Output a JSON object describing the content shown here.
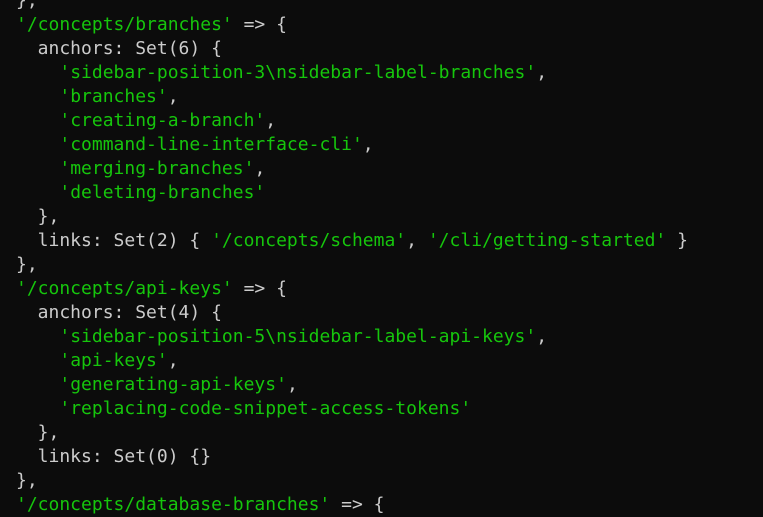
{
  "colors": {
    "background": "#0c0c0c",
    "text": "#cccccc",
    "string": "#16c60c"
  },
  "lines": [
    [
      {
        "t": "p",
        "v": "},"
      }
    ],
    [
      {
        "t": "s",
        "v": "'/concepts/branches'"
      },
      {
        "t": "p",
        "v": " => {"
      }
    ],
    [
      {
        "t": "p",
        "v": "  anchors: Set(6) {"
      }
    ],
    [
      {
        "t": "p",
        "v": "    "
      },
      {
        "t": "s",
        "v": "'sidebar-position-3\\nsidebar-label-branches'"
      },
      {
        "t": "p",
        "v": ","
      }
    ],
    [
      {
        "t": "p",
        "v": "    "
      },
      {
        "t": "s",
        "v": "'branches'"
      },
      {
        "t": "p",
        "v": ","
      }
    ],
    [
      {
        "t": "p",
        "v": "    "
      },
      {
        "t": "s",
        "v": "'creating-a-branch'"
      },
      {
        "t": "p",
        "v": ","
      }
    ],
    [
      {
        "t": "p",
        "v": "    "
      },
      {
        "t": "s",
        "v": "'command-line-interface-cli'"
      },
      {
        "t": "p",
        "v": ","
      }
    ],
    [
      {
        "t": "p",
        "v": "    "
      },
      {
        "t": "s",
        "v": "'merging-branches'"
      },
      {
        "t": "p",
        "v": ","
      }
    ],
    [
      {
        "t": "p",
        "v": "    "
      },
      {
        "t": "s",
        "v": "'deleting-branches'"
      }
    ],
    [
      {
        "t": "p",
        "v": "  },"
      }
    ],
    [
      {
        "t": "p",
        "v": "  links: Set(2) { "
      },
      {
        "t": "s",
        "v": "'/concepts/schema'"
      },
      {
        "t": "p",
        "v": ", "
      },
      {
        "t": "s",
        "v": "'/cli/getting-started'"
      },
      {
        "t": "p",
        "v": " }"
      }
    ],
    [
      {
        "t": "p",
        "v": "},"
      }
    ],
    [
      {
        "t": "s",
        "v": "'/concepts/api-keys'"
      },
      {
        "t": "p",
        "v": " => {"
      }
    ],
    [
      {
        "t": "p",
        "v": "  anchors: Set(4) {"
      }
    ],
    [
      {
        "t": "p",
        "v": "    "
      },
      {
        "t": "s",
        "v": "'sidebar-position-5\\nsidebar-label-api-keys'"
      },
      {
        "t": "p",
        "v": ","
      }
    ],
    [
      {
        "t": "p",
        "v": "    "
      },
      {
        "t": "s",
        "v": "'api-keys'"
      },
      {
        "t": "p",
        "v": ","
      }
    ],
    [
      {
        "t": "p",
        "v": "    "
      },
      {
        "t": "s",
        "v": "'generating-api-keys'"
      },
      {
        "t": "p",
        "v": ","
      }
    ],
    [
      {
        "t": "p",
        "v": "    "
      },
      {
        "t": "s",
        "v": "'replacing-code-snippet-access-tokens'"
      }
    ],
    [
      {
        "t": "p",
        "v": "  },"
      }
    ],
    [
      {
        "t": "p",
        "v": "  links: Set(0) {}"
      }
    ],
    [
      {
        "t": "p",
        "v": "},"
      }
    ],
    [
      {
        "t": "s",
        "v": "'/concepts/database-branches'"
      },
      {
        "t": "p",
        "v": " => {"
      }
    ]
  ]
}
